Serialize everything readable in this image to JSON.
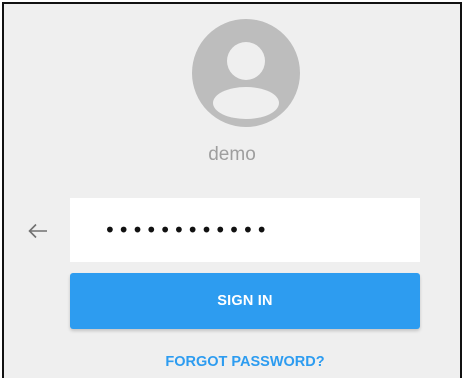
{
  "user": {
    "username": "demo",
    "avatar_icon": "account-circle-icon"
  },
  "password": {
    "value": "demopassword",
    "placeholder": ""
  },
  "actions": {
    "back_icon": "arrow-left-icon",
    "signin_label": "SIGN IN",
    "forgot_label": "FORGOT PASSWORD?"
  },
  "colors": {
    "accent": "#2d9cf0",
    "background": "#efefef",
    "avatar": "#bdbdbd",
    "muted_text": "#9e9e9e"
  }
}
